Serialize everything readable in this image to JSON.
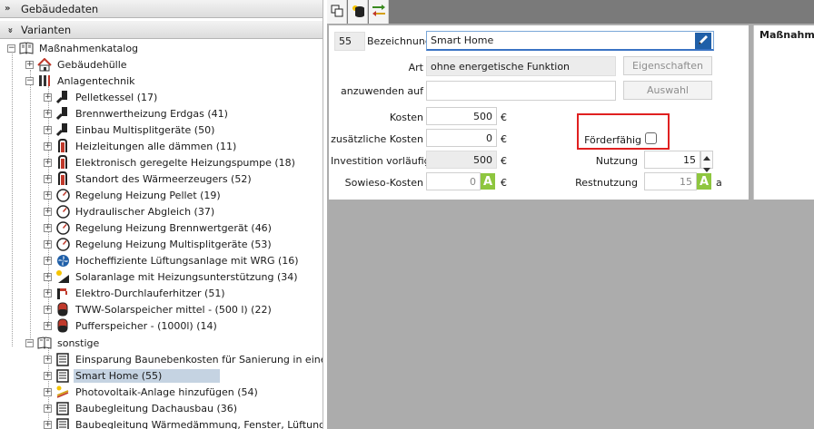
{
  "sections": {
    "gebaeudedaten": "Gebäudedaten",
    "varianten": "Varianten"
  },
  "tree": {
    "root": "Maßnahmenkatalog",
    "gebaeudehuelle": "Gebäudehülle",
    "anlagentechnik": "Anlagentechnik",
    "anlagen_items": [
      {
        "label": "Pelletkessel (17)",
        "icon": "boiler-icon"
      },
      {
        "label": "Brennwertheizung Erdgas (41)",
        "icon": "boiler-icon"
      },
      {
        "label": "Einbau Multisplitgeräte (50)",
        "icon": "boiler-icon"
      },
      {
        "label": "Heizleitungen alle dämmen (11)",
        "icon": "pipe-icon"
      },
      {
        "label": "Elektronisch geregelte Heizungspumpe (18)",
        "icon": "pipe-icon"
      },
      {
        "label": "Standort des Wärmeerzeugers (52)",
        "icon": "pipe-icon"
      },
      {
        "label": "Regelung Heizung Pellet (19)",
        "icon": "gauge-icon"
      },
      {
        "label": "Hydraulischer Abgleich (37)",
        "icon": "gauge-icon"
      },
      {
        "label": "Regelung Heizung Brennwertgerät (46)",
        "icon": "gauge-icon"
      },
      {
        "label": "Regelung Heizung Multisplitgeräte (53)",
        "icon": "gauge-icon"
      },
      {
        "label": "Hocheffiziente Lüftungsanlage mit WRG (16)",
        "icon": "fan-icon"
      },
      {
        "label": "Solaranlage mit Heizungsunterstützung (34)",
        "icon": "solar-icon"
      },
      {
        "label": "Elektro-Durchlauferhitzer (51)",
        "icon": "faucet-icon"
      },
      {
        "label": "TWW-Solarspeicher mittel - (500 l) (22)",
        "icon": "tank-icon"
      },
      {
        "label": "Pufferspeicher - (1000l) (14)",
        "icon": "tank-icon"
      }
    ],
    "sonstige": "sonstige",
    "sonstige_items": [
      {
        "label": "Einsparung Baunebenkosten für Sanierung in einem Zug",
        "icon": "document-icon"
      },
      {
        "label": "Smart Home (55)",
        "icon": "document-icon",
        "selected": true
      },
      {
        "label": "Photovoltaik-Anlage hinzufügen (54)",
        "icon": "pv-icon"
      },
      {
        "label": "Baubegleitung Dachausbau (36)",
        "icon": "document-icon"
      },
      {
        "label": "Baubegleitung Wärmedämmung, Fenster, Lüftungsanlag",
        "icon": "document-icon"
      }
    ]
  },
  "form": {
    "id": "55",
    "bezeichnung_label": "Bezeichnung",
    "bezeichnung_value": "Smart Home",
    "art_label": "Art",
    "art_value": "ohne energetische Funktion",
    "eigenschaften_button": "Eigenschaften",
    "anzuwenden_label": "anzuwenden auf",
    "anzuwenden_value": "",
    "auswahl_button": "Auswahl",
    "kosten_label": "Kosten",
    "kosten_value": "500",
    "zusaetzliche_label": "zusätzliche Kosten",
    "zusaetzliche_value": "0",
    "investition_label": "Investition vorläufig",
    "investition_value": "500",
    "sowieso_label": "Sowieso-Kosten",
    "sowieso_value": "0",
    "currency": "€",
    "foerderfaehig_label": "Förderfähig",
    "foerderfaehig_checked": false,
    "nutzung_label": "Nutzung",
    "nutzung_value": "15",
    "restnutzung_label": "Restnutzung",
    "restnutzung_value": "15",
    "restnutzung_unit": "a",
    "auto_badge": "A"
  },
  "right_panel": {
    "title": "Maßnahmenk"
  },
  "colors": {
    "accent_green": "#8ec63f",
    "highlight_red": "#e02020",
    "selection": "#c5d3e2"
  }
}
